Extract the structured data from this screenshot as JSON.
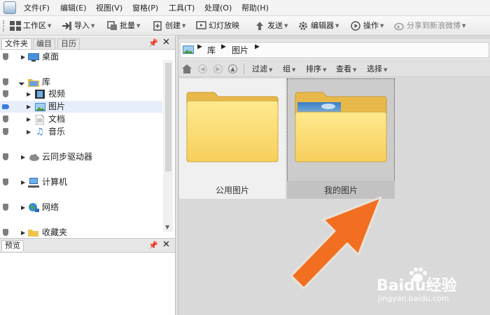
{
  "menubar": {
    "items": [
      "文件(F)",
      "编辑(E)",
      "视图(V)",
      "窗格(P)",
      "工具(T)",
      "处理(O)",
      "帮助(H)"
    ]
  },
  "toolbar": {
    "workspace": "工作区",
    "import": "导入",
    "batch": "批量",
    "create": "创建",
    "slideshow": "幻灯放映",
    "send": "发送",
    "editor": "编辑器",
    "actions": "操作",
    "share": "分享到新浪微博"
  },
  "left_panel": {
    "tabs": [
      "文件夹",
      "编目",
      "日历"
    ],
    "tree": {
      "desktop": "桌面",
      "library": "库",
      "videos": "视频",
      "pictures": "图片",
      "documents": "文档",
      "music": "音乐",
      "cloud_drive": "云同步驱动器",
      "computer": "计算机",
      "network": "网络",
      "favorites": "收藏夹"
    },
    "preview_title": "预览"
  },
  "address": {
    "crumbs": [
      "库",
      "图片"
    ]
  },
  "commandbar": {
    "filter": "过滤",
    "group": "组",
    "sort": "排序",
    "view": "查看",
    "select": "选择"
  },
  "content": {
    "folders": [
      {
        "name": "公用图片"
      },
      {
        "name": "我的图片"
      }
    ]
  },
  "watermark": {
    "brand": "Baidu经验",
    "url": "jingyan.baidu.com"
  },
  "colors": {
    "arrow": "#f26f21",
    "folder": "#ffd96a",
    "selection": "#e6eefb"
  }
}
